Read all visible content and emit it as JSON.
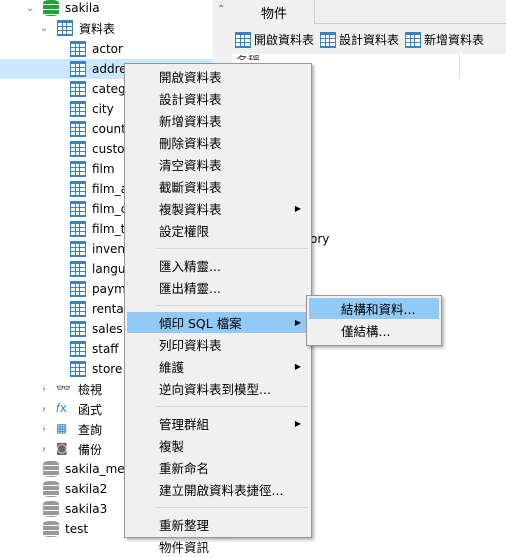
{
  "tree": {
    "database": "sakila",
    "tables_folder": "資料表",
    "tables": [
      "actor",
      "address",
      "category",
      "city",
      "country",
      "customer",
      "film",
      "film_actor",
      "film_category",
      "film_text",
      "inventory",
      "language",
      "payment",
      "rental",
      "sales",
      "staff",
      "store"
    ],
    "selected": "address",
    "folders": [
      {
        "label": "檢視",
        "icon": "view-icon"
      },
      {
        "label": "函式",
        "icon": "function-icon"
      },
      {
        "label": "查詢",
        "icon": "query-icon"
      },
      {
        "label": "備份",
        "icon": "backup-icon"
      }
    ],
    "other_databases": [
      "sakila_merge",
      "sakila2",
      "sakila3",
      "test"
    ]
  },
  "right": {
    "tab": "物件",
    "toolbar": [
      "開啟資料表",
      "設計資料表",
      "新增資料表"
    ],
    "column_header": "名稱",
    "partial_text": "ory"
  },
  "menu": {
    "groups": [
      [
        {
          "label": "開啟資料表"
        },
        {
          "label": "設計資料表"
        },
        {
          "label": "新增資料表"
        },
        {
          "label": "刪除資料表"
        },
        {
          "label": "清空資料表"
        },
        {
          "label": "截斷資料表"
        },
        {
          "label": "複製資料表",
          "submenu": true
        },
        {
          "label": "設定權限"
        }
      ],
      [
        {
          "label": "匯入精靈..."
        },
        {
          "label": "匯出精靈..."
        }
      ],
      [
        {
          "label": "傾印 SQL 檔案",
          "submenu": true,
          "highlighted": true
        },
        {
          "label": "列印資料表"
        },
        {
          "label": "維護",
          "submenu": true
        },
        {
          "label": "逆向資料表到模型..."
        }
      ],
      [
        {
          "label": "管理群組",
          "submenu": true
        },
        {
          "label": "複製"
        },
        {
          "label": "重新命名"
        },
        {
          "label": "建立開啟資料表捷徑..."
        }
      ],
      [
        {
          "label": "重新整理"
        },
        {
          "label": "物件資訊"
        }
      ]
    ],
    "submenu": [
      {
        "label": "結構和資料...",
        "highlighted": true
      },
      {
        "label": "僅結構..."
      }
    ]
  },
  "colors": {
    "selection": "#cce8ff",
    "menu_highlight": "#91c9f7",
    "table_icon": "#3b82c4",
    "db_active": "#22a33a"
  }
}
